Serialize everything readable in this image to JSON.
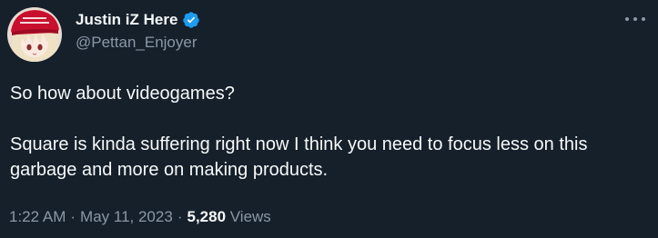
{
  "author": {
    "display_name": "Justin iZ Here",
    "handle": "@Pettan_Enjoyer",
    "verified": true,
    "avatar_icon": "anime-avatar-red-cap"
  },
  "tweet": {
    "paragraphs": [
      "So how about videogames?",
      "Square is kinda suffering right now I think you need to focus less on this garbage and more on making products."
    ],
    "time": "1:22 AM",
    "date": "May 11, 2023",
    "separator": "·",
    "views_count": "5,280",
    "views_label": "Views"
  },
  "icons": {
    "more": "more-horizontal-icon",
    "verified": "verified-badge-icon"
  },
  "colors": {
    "background": "#15202b",
    "text_primary": "#f7f9f9",
    "text_secondary": "#8b98a5",
    "verified_blue": "#1d9bf0",
    "cap_red": "#c8102e"
  }
}
